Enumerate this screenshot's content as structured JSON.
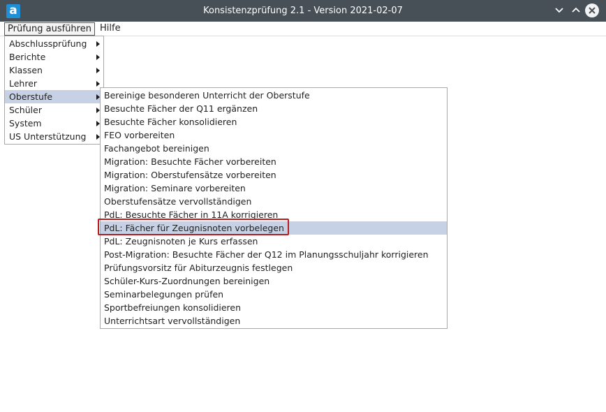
{
  "window": {
    "logo_letter": "a",
    "title": "Konsistenzprüfung 2.1 - Version 2021-02-07",
    "accent_color": "#1f8fd6",
    "titlebar_color": "#475057"
  },
  "menubar": {
    "items": [
      {
        "label": "Prüfung ausführen"
      },
      {
        "label": "Hilfe"
      }
    ]
  },
  "main_menu": {
    "items": [
      {
        "label": "Abschlussprüfung"
      },
      {
        "label": "Berichte"
      },
      {
        "label": "Klassen"
      },
      {
        "label": "Lehrer"
      },
      {
        "label": "Oberstufe"
      },
      {
        "label": "Schüler"
      },
      {
        "label": "System"
      },
      {
        "label": "US Unterstützung"
      }
    ],
    "selected": "Oberstufe"
  },
  "submenu": {
    "items": [
      {
        "label": "Bereinige besonderen Unterricht der Oberstufe"
      },
      {
        "label": "Besuchte Fächer der Q11 ergänzen"
      },
      {
        "label": "Besuchte Fächer konsolidieren"
      },
      {
        "label": "FEO vorbereiten"
      },
      {
        "label": "Fachangebot bereinigen"
      },
      {
        "label": "Migration: Besuchte Fächer vorbereiten"
      },
      {
        "label": "Migration: Oberstufensätze vorbereiten"
      },
      {
        "label": "Migration: Seminare vorbereiten"
      },
      {
        "label": "Oberstufensätze vervollständigen"
      },
      {
        "label": "PdL: Besuchte Fächer in 11A korrigieren"
      },
      {
        "label": "PdL: Fächer für Zeugnisnoten vorbelegen"
      },
      {
        "label": "PdL: Zeugnisnoten je Kurs erfassen"
      },
      {
        "label": "Post-Migration: Besuchte Fächer der Q12 im Planungsschuljahr korrigieren"
      },
      {
        "label": "Prüfungsvorsitz für Abiturzeugnis festlegen"
      },
      {
        "label": "Schüler-Kurs-Zuordnungen bereinigen"
      },
      {
        "label": "Seminarbelegungen prüfen"
      },
      {
        "label": "Sportbefreiungen konsolidieren"
      },
      {
        "label": "Unterrichtsart vervollständigen"
      }
    ],
    "selected": "PdL: Fächer für Zeugnisnoten vorbelegen"
  }
}
